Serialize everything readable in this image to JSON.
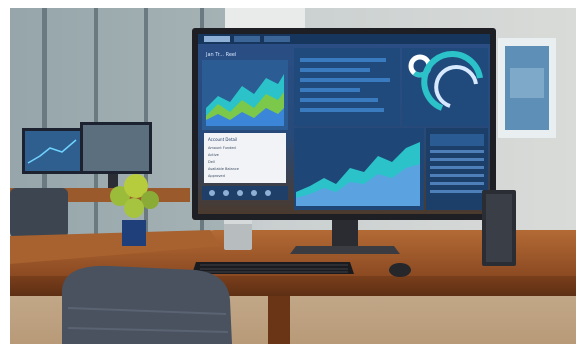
{
  "photo": {
    "description_free": true
  },
  "monitor_screen": {
    "header_text": "Jan Tr... Reel",
    "card": {
      "heading": "Account Detail",
      "lines": [
        "Amount Funded",
        "Active",
        "Dell",
        "Available Balance",
        "Approved"
      ]
    },
    "tabs": [
      "",
      "",
      "",
      ""
    ]
  },
  "colors": {
    "wall": "#bfc8cf",
    "desk": "#a2602f",
    "monitor_bezel": "#1d1f24",
    "screen_bg": "#0f2a4a",
    "accent_teal": "#2bc3c9",
    "accent_green": "#7bc84a",
    "accent_blue": "#3b86d8"
  }
}
